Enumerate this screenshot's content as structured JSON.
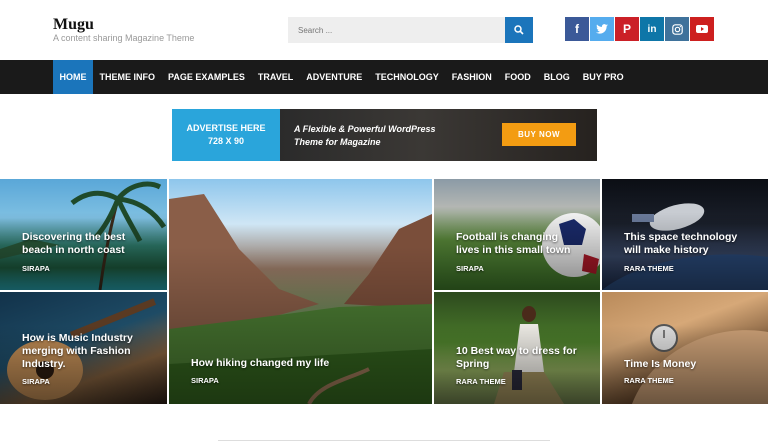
{
  "header": {
    "site_title": "Mugu",
    "tagline": "A content sharing Magazine Theme",
    "search": {
      "placeholder": "Search ..."
    },
    "social": [
      "facebook-icon",
      "twitter-icon",
      "pinterest-icon",
      "linkedin-icon",
      "instagram-icon",
      "youtube-icon"
    ]
  },
  "nav": {
    "items": [
      {
        "label": "HOME",
        "active": true
      },
      {
        "label": "THEME INFO"
      },
      {
        "label": "PAGE EXAMPLES"
      },
      {
        "label": "TRAVEL"
      },
      {
        "label": "ADVENTURE"
      },
      {
        "label": "TECHNOLOGY"
      },
      {
        "label": "FASHION"
      },
      {
        "label": "FOOD"
      },
      {
        "label": "BLOG"
      },
      {
        "label": "BUY PRO"
      }
    ]
  },
  "banner": {
    "left_line1": "ADVERTISE HERE",
    "left_line2": "728 X 90",
    "text": "A Flexible & Powerful WordPress Theme for Magazine",
    "button": "BUY NOW"
  },
  "posts": [
    {
      "title": "Discovering the best beach in north coast",
      "author": "SIRAPA"
    },
    {
      "title": "How is Music Industry merging with Fashion Industry.",
      "author": "SIRAPA"
    },
    {
      "title": "How hiking changed my life",
      "author": "SIRAPA"
    },
    {
      "title": "Football is changing lives in this small town",
      "author": "SIRAPA"
    },
    {
      "title": "10 Best way to dress for Spring",
      "author": "RARA THEME"
    },
    {
      "title": "This space technology will make history",
      "author": "RARA THEME"
    },
    {
      "title": "Time Is Money",
      "author": "RARA THEME"
    }
  ],
  "colors": {
    "accent": "#1b75bb",
    "nav_bg": "#1a1a1a",
    "banner_left": "#2aa5db",
    "buy_button": "#f39c12"
  }
}
